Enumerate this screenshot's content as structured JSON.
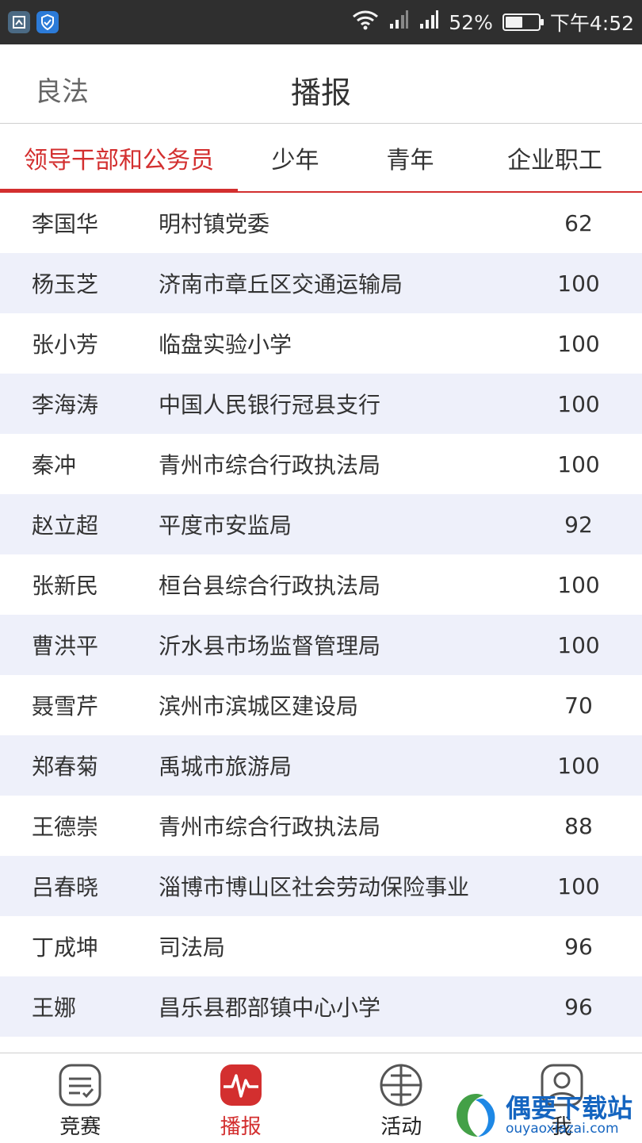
{
  "status_bar": {
    "battery": "52%",
    "time": "下午4:52",
    "battery_level": 0.52
  },
  "header": {
    "back_label": "良法",
    "title": "播报"
  },
  "tabs": [
    {
      "label": "领导干部和公务员",
      "active": true
    },
    {
      "label": "少年",
      "active": false
    },
    {
      "label": "青年",
      "active": false
    },
    {
      "label": "企业职工",
      "active": false
    }
  ],
  "list": [
    {
      "name": "李国华",
      "org": "明村镇党委",
      "score": "62"
    },
    {
      "name": "杨玉芝",
      "org": "济南市章丘区交通运输局",
      "score": "100"
    },
    {
      "name": "张小芳",
      "org": "临盘实验小学",
      "score": "100"
    },
    {
      "name": "李海涛",
      "org": "中国人民银行冠县支行",
      "score": "100"
    },
    {
      "name": "秦冲",
      "org": "青州市综合行政执法局",
      "score": "100"
    },
    {
      "name": "赵立超",
      "org": "平度市安监局",
      "score": "92"
    },
    {
      "name": "张新民",
      "org": "桓台县综合行政执法局",
      "score": "100"
    },
    {
      "name": "曹洪平",
      "org": "沂水县市场监督管理局",
      "score": "100"
    },
    {
      "name": "聂雪芹",
      "org": "滨州市滨城区建设局",
      "score": "70"
    },
    {
      "name": "郑春菊",
      "org": "禹城市旅游局",
      "score": "100"
    },
    {
      "name": "王德崇",
      "org": "青州市综合行政执法局",
      "score": "88"
    },
    {
      "name": "吕春晓",
      "org": "淄博市博山区社会劳动保险事业",
      "score": "100"
    },
    {
      "name": "丁成坤",
      "org": "司法局",
      "score": "96"
    },
    {
      "name": "王娜",
      "org": "昌乐县郡部镇中心小学",
      "score": "96"
    }
  ],
  "bottom_nav": [
    {
      "label": "竞赛",
      "icon": "quiz-icon",
      "active": false
    },
    {
      "label": "播报",
      "icon": "pulse-icon",
      "active": true
    },
    {
      "label": "活动",
      "icon": "activity-grid-icon",
      "active": false
    },
    {
      "label": "我",
      "icon": "profile-icon",
      "active": false
    }
  ],
  "watermark": {
    "cn": "偶要下载站",
    "en": "ouyaoxiazai.com"
  },
  "colors": {
    "accent": "#d32f2f",
    "stripe": "#eef0fa",
    "statusbar": "#2f2f2f"
  }
}
